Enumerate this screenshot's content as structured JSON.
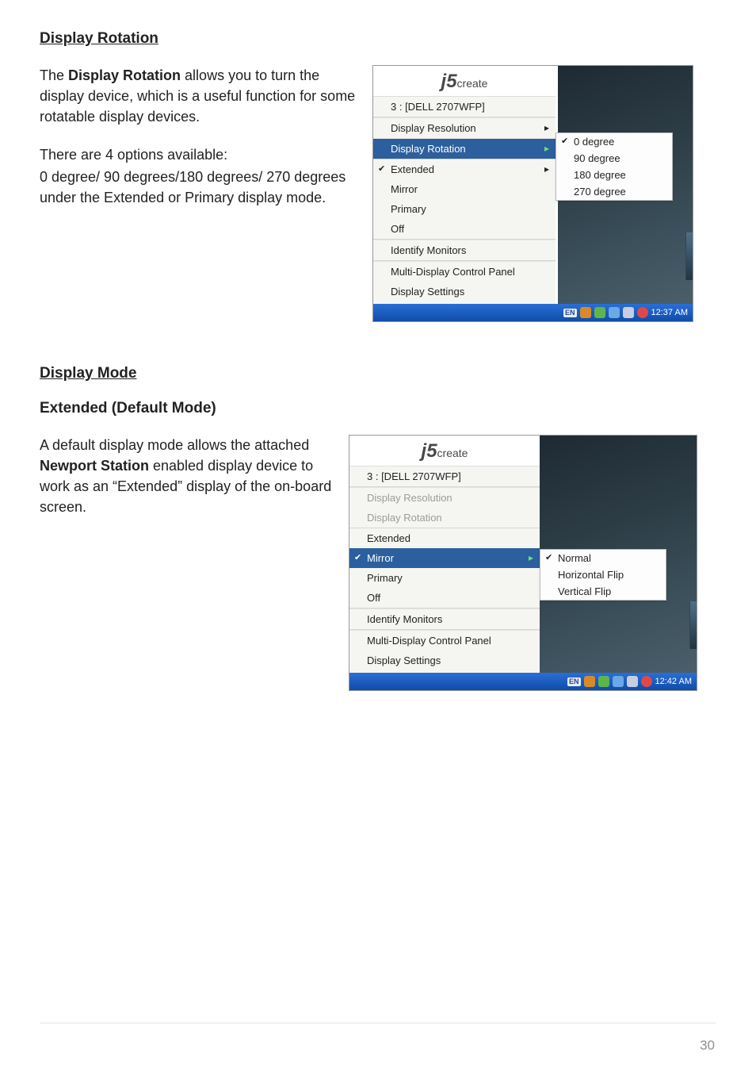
{
  "section1": {
    "heading": "Display Rotation",
    "para1_pre": "The ",
    "para1_bold": "Display Rotation",
    "para1_post": " allows you to turn the display device, which is a useful function for some rotatable display devices.",
    "para2": "There are 4 options available:",
    "para3": "0 degree/ 90 degrees/180 degrees/ 270 degrees under the Extended or Primary display mode.",
    "menu": {
      "logo_j5": "j5",
      "logo_create": "create",
      "title_item": "3 : [DELL 2707WFP]",
      "items": [
        {
          "label": "Display Resolution",
          "arrow": true
        },
        {
          "label": "Display Rotation",
          "arrow": true,
          "highlight": true
        },
        {
          "label": "Extended",
          "checked": true,
          "arrow": true
        },
        {
          "label": "Mirror"
        },
        {
          "label": "Primary"
        },
        {
          "label": "Off"
        },
        {
          "label": "Identify Monitors"
        },
        {
          "label": "Multi-Display Control Panel"
        },
        {
          "label": "Display Settings"
        }
      ],
      "submenu": [
        "0 degree",
        "90 degree",
        "180 degree",
        "270 degree"
      ],
      "submenu_checked_index": 0
    },
    "taskbar_time": "12:37 AM"
  },
  "section2": {
    "heading": "Display Mode",
    "subheading": "Extended (Default Mode)",
    "para1_pre": "A default display mode allows the attached ",
    "para1_bold": "Newport Station",
    "para1_post": " enabled display device to work as an “Extended” display of the on-board screen.",
    "menu": {
      "logo_j5": "j5",
      "logo_create": "create",
      "title_item": "3 : [DELL 2707WFP]",
      "items": [
        {
          "label": "Display Resolution",
          "disabled": true
        },
        {
          "label": "Display Rotation",
          "disabled": true
        },
        {
          "label": "Extended"
        },
        {
          "label": "Mirror",
          "checked": true,
          "arrow": true,
          "highlight": true
        },
        {
          "label": "Primary"
        },
        {
          "label": "Off"
        },
        {
          "label": "Identify Monitors"
        },
        {
          "label": "Multi-Display Control Panel"
        },
        {
          "label": "Display Settings"
        }
      ],
      "submenu": [
        "Normal",
        "Horizontal Flip",
        "Vertical Flip"
      ],
      "submenu_checked_index": 0
    },
    "taskbar_time": "12:42 AM"
  },
  "taskbar_lang": "EN",
  "page_number": "30"
}
